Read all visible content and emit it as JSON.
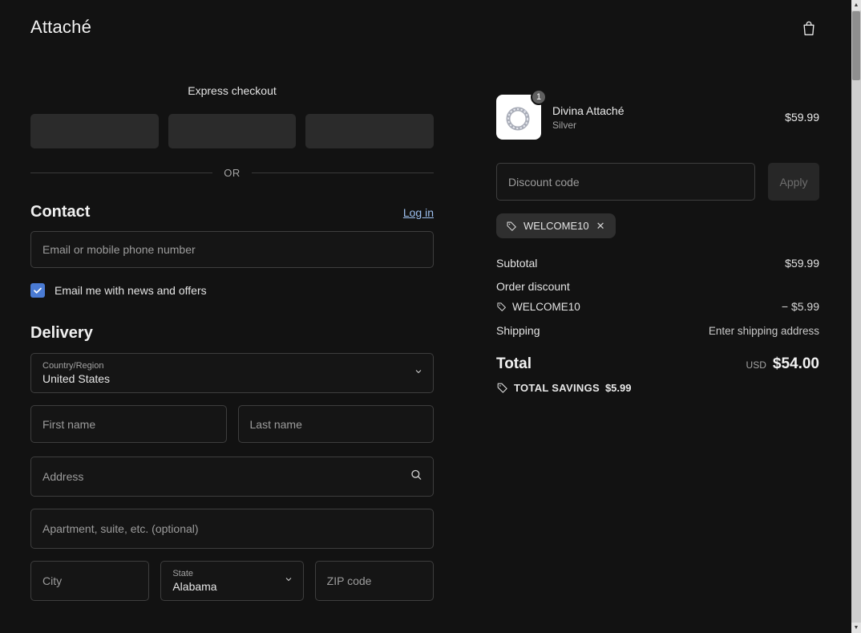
{
  "header": {
    "store_name": "Attaché"
  },
  "express": {
    "title": "Express checkout",
    "divider_label": "OR"
  },
  "contact": {
    "heading": "Contact",
    "login_label": "Log in",
    "email_placeholder": "Email or mobile phone number",
    "newsletter_label": "Email me with news and offers",
    "newsletter_checked": true
  },
  "delivery": {
    "heading": "Delivery",
    "country_label": "Country/Region",
    "country_value": "United States",
    "first_name_placeholder": "First name",
    "last_name_placeholder": "Last name",
    "address_placeholder": "Address",
    "apartment_placeholder": "Apartment, suite, etc. (optional)",
    "city_placeholder": "City",
    "state_label": "State",
    "state_value": "Alabama",
    "zip_placeholder": "ZIP code"
  },
  "summary": {
    "item": {
      "name": "Divina Attaché",
      "variant": "Silver",
      "quantity": "1",
      "price": "$59.99"
    },
    "discount_placeholder": "Discount code",
    "apply_label": "Apply",
    "applied_code": "WELCOME10",
    "subtotal_label": "Subtotal",
    "subtotal_value": "$59.99",
    "order_discount_label": "Order discount",
    "discount_code": "WELCOME10",
    "discount_amount": "− $5.99",
    "shipping_label": "Shipping",
    "shipping_value": "Enter shipping address",
    "total_label": "Total",
    "currency": "USD",
    "total_value": "$54.00",
    "savings_label": "TOTAL SAVINGS",
    "savings_value": "$5.99"
  },
  "colors": {
    "background": "#121212",
    "link": "#9dc0ef",
    "checkbox": "#4a7bd4",
    "input_border": "#3e3e3e"
  }
}
